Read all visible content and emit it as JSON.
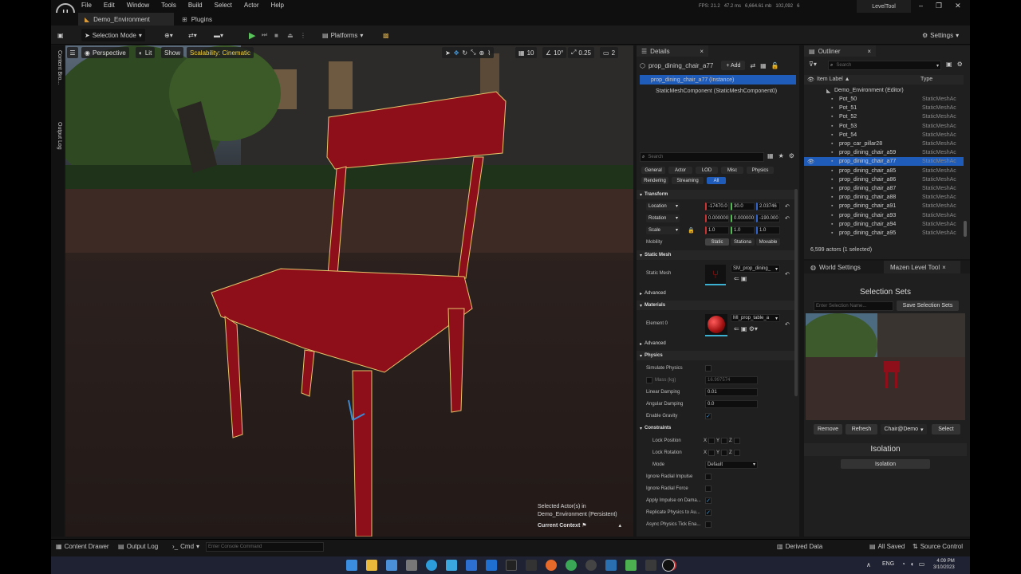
{
  "menu": [
    "File",
    "Edit",
    "Window",
    "Tools",
    "Build",
    "Select",
    "Actor",
    "Help"
  ],
  "perf": {
    "fps": "FPS: 21.2",
    "ms": "47.2 ms",
    "mem": "6,664.61 mb",
    "objs": "102,092",
    "stalls": "6"
  },
  "window_title": "LevelTool",
  "tabs": {
    "main": "Demo_Environment",
    "plugins": "Plugins"
  },
  "toolbar": {
    "selection_mode": "Selection Mode",
    "platforms": "Platforms",
    "settings": "Settings"
  },
  "viewport": {
    "perspective": "Perspective",
    "lit": "Lit",
    "show": "Show",
    "scalability": "Scalability: Cinematic",
    "grid": "10",
    "angle": "10°",
    "scale": "0.25",
    "cam": "2",
    "overlay_line1": "Selected Actor(s) in",
    "overlay_line2": "Demo_Environment (Persistent)",
    "context": "Current Context"
  },
  "side_labels": {
    "content": "Content Bro...",
    "output": "Output Log"
  },
  "details": {
    "tab": "Details",
    "actor_name": "prop_dining_chair_a77",
    "add": "+ Add",
    "instance": "prop_dining_chair_a77 (Instance)",
    "component": "StaticMeshComponent (StaticMeshComponent0)",
    "search_placeholder": "Search",
    "filters_row1": [
      "General",
      "Actor",
      "LOD",
      "Misc",
      "Physics"
    ],
    "filters_row2": [
      "Rendering",
      "Streaming",
      "All"
    ],
    "sections": {
      "transform": "Transform",
      "static_mesh": "Static Mesh",
      "advanced": "Advanced",
      "materials": "Materials",
      "physics": "Physics",
      "constraints": "Constraints"
    },
    "location": {
      "label": "Location",
      "x": "-17470.0",
      "y": "30.0",
      "z": "2.03746"
    },
    "rotation": {
      "label": "Rotation",
      "x": "0.000000",
      "y": "0.000000",
      "z": "-190.000"
    },
    "scale": {
      "label": "Scale",
      "x": "1.0",
      "y": "1.0",
      "z": "1.0"
    },
    "mobility": {
      "label": "Mobility",
      "opts": [
        "Static",
        "Stationa",
        "Movable"
      ]
    },
    "static_mesh": {
      "label": "Static Mesh",
      "value": "SM_prop_dining_"
    },
    "element0": {
      "label": "Element 0",
      "value": "MI_prop_table_a"
    },
    "physics": {
      "simulate": "Simulate Physics",
      "mass": "Mass (kg)",
      "mass_val": "16.997574",
      "linear": "Linear Damping",
      "linear_val": "0.01",
      "angular": "Angular Damping",
      "angular_val": "0.0",
      "gravity": "Enable Gravity",
      "lock_pos": "Lock Position",
      "lock_rot": "Lock Rotation",
      "mode": "Mode",
      "mode_val": "Default",
      "radial_impulse": "Ignore Radial Impulse",
      "radial_force": "Ignore Radial Force",
      "apply_impulse": "Apply Impulse on Dama...",
      "replicate": "Replicate Physics to Au...",
      "async": "Async Physics Tick Ena...",
      "xyz": [
        "X",
        "Y",
        "Z"
      ]
    }
  },
  "outliner": {
    "tab": "Outliner",
    "search_placeholder": "Search",
    "col_label": "Item Label ▲",
    "col_type": "Type",
    "root": "Demo_Environment (Editor)",
    "items": [
      {
        "name": "Pot_50",
        "type": "StaticMeshAc"
      },
      {
        "name": "Pot_51",
        "type": "StaticMeshAc"
      },
      {
        "name": "Pot_52",
        "type": "StaticMeshAc"
      },
      {
        "name": "Pot_53",
        "type": "StaticMeshAc"
      },
      {
        "name": "Pot_54",
        "type": "StaticMeshAc"
      },
      {
        "name": "prop_car_pillar28",
        "type": "StaticMeshAc"
      },
      {
        "name": "prop_dining_chair_a59",
        "type": "StaticMeshAc"
      },
      {
        "name": "prop_dining_chair_a77",
        "type": "StaticMeshAc",
        "selected": true
      },
      {
        "name": "prop_dining_chair_a85",
        "type": "StaticMeshAc"
      },
      {
        "name": "prop_dining_chair_a86",
        "type": "StaticMeshAc"
      },
      {
        "name": "prop_dining_chair_a87",
        "type": "StaticMeshAc"
      },
      {
        "name": "prop_dining_chair_a88",
        "type": "StaticMeshAc"
      },
      {
        "name": "prop_dining_chair_a91",
        "type": "StaticMeshAc"
      },
      {
        "name": "prop_dining_chair_a93",
        "type": "StaticMeshAc"
      },
      {
        "name": "prop_dining_chair_a94",
        "type": "StaticMeshAc"
      },
      {
        "name": "prop_dining_chair_a95",
        "type": "StaticMeshAc"
      }
    ],
    "count": "6,599 actors (1 selected)"
  },
  "tool": {
    "tab_world": "World Settings",
    "tab_tool": "Mazen Level Tool",
    "title": "Selection Sets",
    "name_placeholder": "Enter Selection Name...",
    "save": "Save Selection Sets",
    "remove": "Remove",
    "refresh": "Refresh",
    "set": "Chair@Demo",
    "select": "Select",
    "isolation_title": "Isolation",
    "isolation_btn": "Isolation"
  },
  "status": {
    "content_drawer": "Content Drawer",
    "output_log": "Output Log",
    "cmd": "Cmd",
    "console_placeholder": "Enter Console Command",
    "derived": "Derived Data",
    "saved": "All Saved",
    "source": "Source Control"
  },
  "taskbar": {
    "lang": "ENG",
    "time": "4:09 PM",
    "date": "3/10/2023"
  }
}
